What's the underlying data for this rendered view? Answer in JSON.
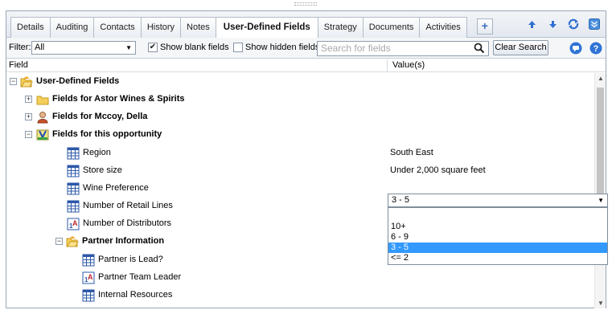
{
  "tabs": [
    {
      "label": "Details",
      "active": false
    },
    {
      "label": "Auditing",
      "active": false
    },
    {
      "label": "Contacts",
      "active": false
    },
    {
      "label": "History",
      "active": false
    },
    {
      "label": "Notes",
      "active": false
    },
    {
      "label": "User-Defined Fields",
      "active": true
    },
    {
      "label": "Strategy",
      "active": false
    },
    {
      "label": "Documents",
      "active": false
    },
    {
      "label": "Activities",
      "active": false
    }
  ],
  "toolbar": {
    "add_tab": "+",
    "icons": [
      "arrow-up-icon",
      "arrow-down-icon",
      "refresh-icon",
      "collapse-icon"
    ]
  },
  "filter": {
    "label": "Filter:",
    "selected": "All",
    "show_blank_label": "Show blank fields",
    "show_blank_checked": true,
    "show_hidden_label": "Show hidden fields",
    "show_hidden_checked": false,
    "search_placeholder": "Search for fields",
    "clear_label": "Clear Search",
    "icons": [
      "chat-icon",
      "help-icon"
    ]
  },
  "columns": {
    "field": "Field",
    "values": "Value(s)"
  },
  "tree": {
    "root": {
      "label": "User-Defined Fields",
      "expanded": true
    },
    "astor": {
      "label": "Fields for Astor Wines & Spirits",
      "expanded": false
    },
    "mccoy": {
      "label": "Fields for Mccoy, Della",
      "expanded": false
    },
    "opportunity": {
      "label": "Fields for this opportunity",
      "expanded": true
    },
    "region": {
      "label": "Region",
      "value": "South East",
      "icon": "table-icon"
    },
    "store_size": {
      "label": "Store size",
      "value": "Under 2,000 square feet",
      "icon": "table-icon"
    },
    "wine_pref": {
      "label": "Wine Preference",
      "value": "",
      "icon": "table-icon"
    },
    "retail_lines": {
      "label": "Number of Retail Lines",
      "value": "3 - 5",
      "icon": "table-icon"
    },
    "distributors": {
      "label": "Number of Distributors",
      "value": "",
      "icon": "number-field-icon"
    },
    "partner": {
      "label": "Partner Information",
      "expanded": true
    },
    "partner_lead": {
      "label": "Partner is Lead?",
      "icon": "table-icon"
    },
    "partner_leader": {
      "label": "Partner Team Leader",
      "icon": "number-field-icon"
    },
    "internal_res": {
      "label": "Internal Resources",
      "icon": "table-icon"
    }
  },
  "dropdown": {
    "selected": "3 - 5",
    "options": [
      "",
      "10+",
      "6 - 9",
      "3 - 5",
      "<= 2"
    ],
    "highlighted_index": 3
  },
  "colors": {
    "accent": "#3399ff",
    "folder": "#f2c84b"
  }
}
